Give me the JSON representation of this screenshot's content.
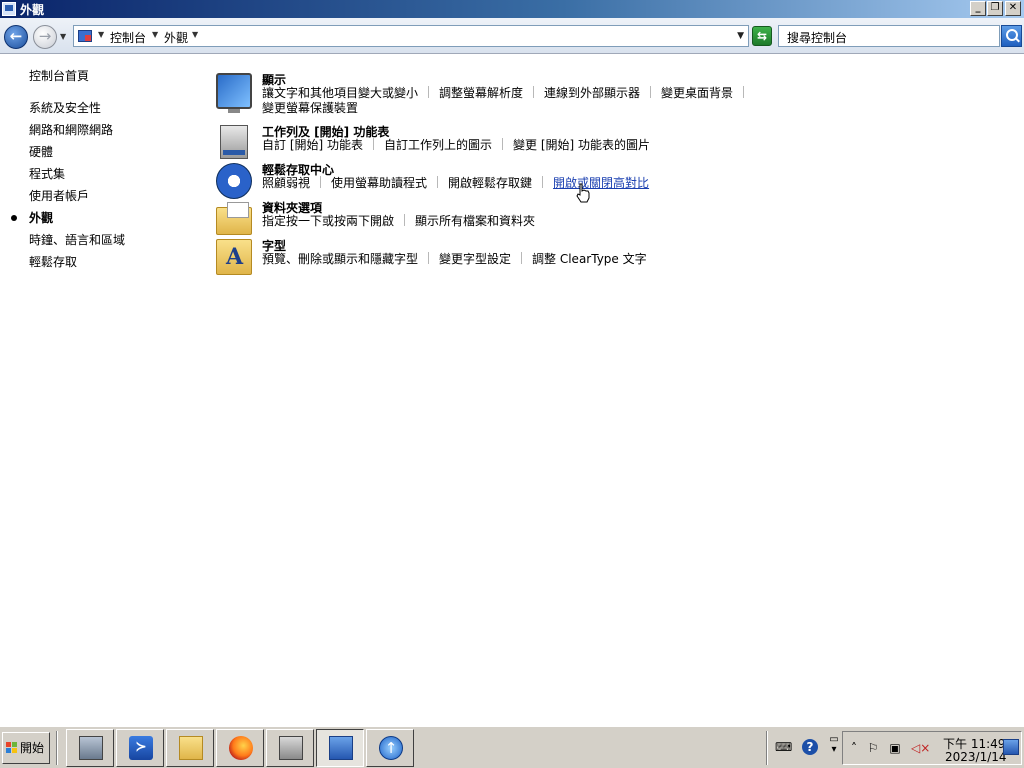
{
  "window": {
    "title": "外觀"
  },
  "address": {
    "breadcrumb": [
      "控制台",
      "外觀"
    ],
    "search_placeholder": "搜尋控制台"
  },
  "leftnav": {
    "items": [
      {
        "label": "控制台首頁",
        "current": false
      },
      {
        "label": "系統及安全性",
        "current": false
      },
      {
        "label": "網路和網際網路",
        "current": false
      },
      {
        "label": "硬體",
        "current": false
      },
      {
        "label": "程式集",
        "current": false
      },
      {
        "label": "使用者帳戶",
        "current": false
      },
      {
        "label": "外觀",
        "current": true
      },
      {
        "label": "時鐘、語言和區域",
        "current": false
      },
      {
        "label": "輕鬆存取",
        "current": false
      }
    ]
  },
  "categories": [
    {
      "title": "顯示",
      "icon": "monitor-icon",
      "links": [
        "讓文字和其他項目變大或變小",
        "調整螢幕解析度",
        "連線到外部顯示器",
        "變更桌面背景",
        "變更螢幕保護裝置"
      ]
    },
    {
      "title": "工作列及 [開始] 功能表",
      "icon": "taskbar-icon",
      "links": [
        "自訂 [開始] 功能表",
        "自訂工作列上的圖示",
        "變更 [開始] 功能表的圖片"
      ]
    },
    {
      "title": "輕鬆存取中心",
      "icon": "ease-of-access-icon",
      "links": [
        "照顧弱視",
        "使用螢幕助讀程式",
        "開啟輕鬆存取鍵",
        "開啟或關閉高對比"
      ]
    },
    {
      "title": "資料夾選項",
      "icon": "folder-options-icon",
      "links": [
        "指定按一下或按兩下開啟",
        "顯示所有檔案和資料夾"
      ]
    },
    {
      "title": "字型",
      "icon": "fonts-icon",
      "links": [
        "預覽、刪除或顯示和隱藏字型",
        "變更字型設定",
        "調整 ClearType 文字"
      ]
    }
  ],
  "taskbar": {
    "start_label": "開始",
    "apps": [
      "server-manager-icon",
      "powershell-icon",
      "file-explorer-icon",
      "firefox-icon",
      "admin-tools-icon",
      "control-panel-icon",
      "windows-update-icon"
    ],
    "clock": {
      "time": "下午 11:49",
      "date": "2023/1/14"
    }
  }
}
